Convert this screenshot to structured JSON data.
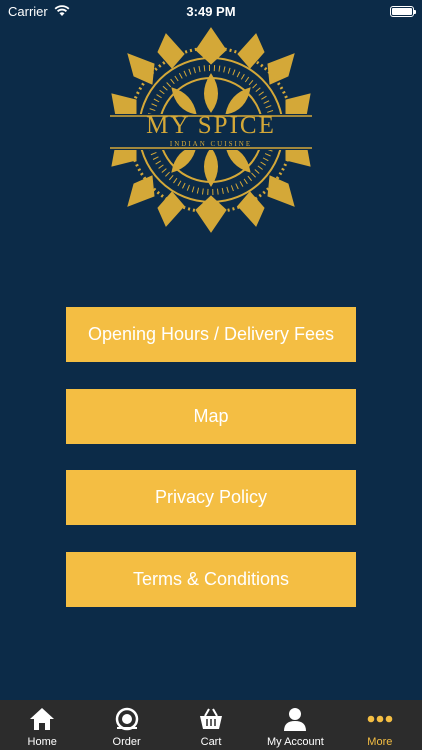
{
  "status_bar": {
    "carrier": "Carrier",
    "time": "3:49 PM"
  },
  "logo": {
    "name": "MY SPICE",
    "subtitle": "INDIAN CUISINE",
    "color": "#d4a838"
  },
  "menu": {
    "opening_hours": "Opening Hours / Delivery Fees",
    "map": "Map",
    "privacy_policy": "Privacy Policy",
    "terms": "Terms & Conditions"
  },
  "tabs": [
    {
      "label": "Home",
      "icon": "home-icon"
    },
    {
      "label": "Order",
      "icon": "order-icon"
    },
    {
      "label": "Cart",
      "icon": "cart-icon"
    },
    {
      "label": "My Account",
      "icon": "account-icon"
    },
    {
      "label": "More",
      "icon": "more-icon",
      "active": true
    }
  ],
  "colors": {
    "background": "#0c2b48",
    "accent": "#f4be43",
    "tab_bar": "#2c2c2c"
  }
}
